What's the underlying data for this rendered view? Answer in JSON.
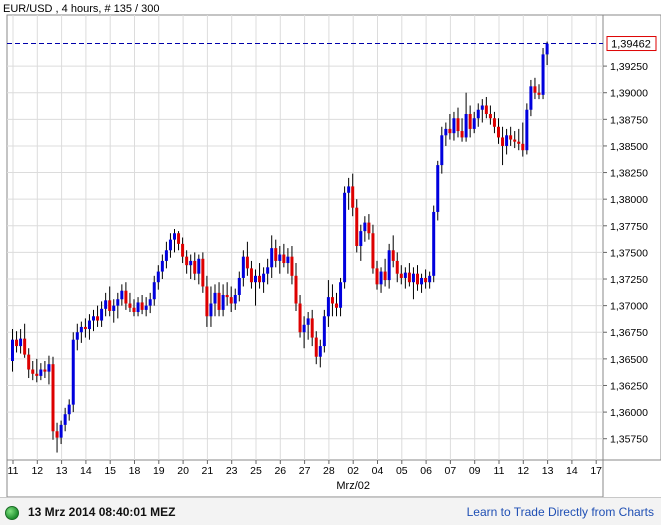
{
  "chart_data": {
    "type": "candlestick",
    "title": "EUR/USD , 4 hours, # 135 / 300",
    "current_price_label": "1,39462",
    "current_price": 1.39462,
    "ylim": [
      1.3555,
      1.3973
    ],
    "yticks": [
      {
        "value": 1.3925,
        "label": "1,39250"
      },
      {
        "value": 1.39,
        "label": "1,39000"
      },
      {
        "value": 1.3875,
        "label": "1,38750"
      },
      {
        "value": 1.385,
        "label": "1,38500"
      },
      {
        "value": 1.3825,
        "label": "1,38250"
      },
      {
        "value": 1.38,
        "label": "1,38000"
      },
      {
        "value": 1.3775,
        "label": "1,37750"
      },
      {
        "value": 1.375,
        "label": "1,37500"
      },
      {
        "value": 1.3725,
        "label": "1,37250"
      },
      {
        "value": 1.37,
        "label": "1,37000"
      },
      {
        "value": 1.3675,
        "label": "1,36750"
      },
      {
        "value": 1.365,
        "label": "1,36500"
      },
      {
        "value": 1.3625,
        "label": "1,36250"
      },
      {
        "value": 1.36,
        "label": "1,36000"
      },
      {
        "value": 1.3575,
        "label": "1,35750"
      }
    ],
    "xticks": [
      "11",
      "12",
      "13",
      "14",
      "15",
      "18",
      "19",
      "20",
      "21",
      "23",
      "25",
      "26",
      "27",
      "28",
      "02",
      "04",
      "05",
      "06",
      "07",
      "09",
      "11",
      "12",
      "13",
      "14",
      "17"
    ],
    "xtick_candle_index": [
      0,
      6,
      12,
      18,
      24,
      30,
      36,
      42,
      48,
      54,
      60,
      66,
      72,
      78,
      84,
      90,
      96,
      102,
      108,
      114,
      120,
      126,
      132,
      138,
      144
    ],
    "xlabel": "Mrz/02",
    "xlabel_candle_index": 84,
    "bull_color": "#0000dd",
    "bear_color": "#dd0000",
    "grid": true,
    "candles": [
      {
        "o": 1.3648,
        "h": 1.3678,
        "l": 1.3638,
        "c": 1.3668
      },
      {
        "o": 1.3668,
        "h": 1.3676,
        "l": 1.3656,
        "c": 1.3662
      },
      {
        "o": 1.3662,
        "h": 1.3678,
        "l": 1.3655,
        "c": 1.3669
      },
      {
        "o": 1.3669,
        "h": 1.3683,
        "l": 1.3651,
        "c": 1.3654
      },
      {
        "o": 1.3654,
        "h": 1.366,
        "l": 1.3632,
        "c": 1.364
      },
      {
        "o": 1.364,
        "h": 1.3648,
        "l": 1.363,
        "c": 1.3636
      },
      {
        "o": 1.3636,
        "h": 1.365,
        "l": 1.3628,
        "c": 1.3634
      },
      {
        "o": 1.3634,
        "h": 1.3646,
        "l": 1.363,
        "c": 1.364
      },
      {
        "o": 1.364,
        "h": 1.3648,
        "l": 1.3632,
        "c": 1.3638
      },
      {
        "o": 1.3638,
        "h": 1.3653,
        "l": 1.3626,
        "c": 1.3645
      },
      {
        "o": 1.3645,
        "h": 1.3652,
        "l": 1.3574,
        "c": 1.3582
      },
      {
        "o": 1.3582,
        "h": 1.359,
        "l": 1.3562,
        "c": 1.3576
      },
      {
        "o": 1.3576,
        "h": 1.3592,
        "l": 1.357,
        "c": 1.3588
      },
      {
        "o": 1.3588,
        "h": 1.3604,
        "l": 1.3582,
        "c": 1.3598
      },
      {
        "o": 1.3598,
        "h": 1.3612,
        "l": 1.3592,
        "c": 1.3607
      },
      {
        "o": 1.3607,
        "h": 1.3675,
        "l": 1.36,
        "c": 1.3668
      },
      {
        "o": 1.3668,
        "h": 1.3683,
        "l": 1.3658,
        "c": 1.3675
      },
      {
        "o": 1.3675,
        "h": 1.3685,
        "l": 1.3665,
        "c": 1.368
      },
      {
        "o": 1.368,
        "h": 1.3688,
        "l": 1.367,
        "c": 1.3678
      },
      {
        "o": 1.3678,
        "h": 1.3692,
        "l": 1.3668,
        "c": 1.3686
      },
      {
        "o": 1.3686,
        "h": 1.3696,
        "l": 1.3676,
        "c": 1.369
      },
      {
        "o": 1.369,
        "h": 1.37,
        "l": 1.368,
        "c": 1.3686
      },
      {
        "o": 1.3686,
        "h": 1.3704,
        "l": 1.368,
        "c": 1.3697
      },
      {
        "o": 1.3697,
        "h": 1.3712,
        "l": 1.369,
        "c": 1.3705
      },
      {
        "o": 1.3705,
        "h": 1.3718,
        "l": 1.369,
        "c": 1.3695
      },
      {
        "o": 1.3695,
        "h": 1.3706,
        "l": 1.3684,
        "c": 1.37
      },
      {
        "o": 1.37,
        "h": 1.3712,
        "l": 1.3688,
        "c": 1.3706
      },
      {
        "o": 1.3706,
        "h": 1.372,
        "l": 1.37,
        "c": 1.3714
      },
      {
        "o": 1.3714,
        "h": 1.3722,
        "l": 1.3696,
        "c": 1.3702
      },
      {
        "o": 1.3702,
        "h": 1.3712,
        "l": 1.3694,
        "c": 1.3698
      },
      {
        "o": 1.3698,
        "h": 1.3706,
        "l": 1.369,
        "c": 1.3694
      },
      {
        "o": 1.3694,
        "h": 1.3708,
        "l": 1.369,
        "c": 1.3703
      },
      {
        "o": 1.3703,
        "h": 1.371,
        "l": 1.3692,
        "c": 1.3696
      },
      {
        "o": 1.3696,
        "h": 1.3708,
        "l": 1.369,
        "c": 1.37
      },
      {
        "o": 1.37,
        "h": 1.3712,
        "l": 1.3693,
        "c": 1.3706
      },
      {
        "o": 1.3706,
        "h": 1.3728,
        "l": 1.37,
        "c": 1.3722
      },
      {
        "o": 1.3722,
        "h": 1.3738,
        "l": 1.3715,
        "c": 1.3732
      },
      {
        "o": 1.3732,
        "h": 1.3748,
        "l": 1.3725,
        "c": 1.3742
      },
      {
        "o": 1.3742,
        "h": 1.376,
        "l": 1.3735,
        "c": 1.3752
      },
      {
        "o": 1.3752,
        "h": 1.3768,
        "l": 1.3745,
        "c": 1.3762
      },
      {
        "o": 1.3762,
        "h": 1.3772,
        "l": 1.375,
        "c": 1.3768
      },
      {
        "o": 1.3768,
        "h": 1.377,
        "l": 1.3752,
        "c": 1.3758
      },
      {
        "o": 1.3758,
        "h": 1.3764,
        "l": 1.374,
        "c": 1.3746
      },
      {
        "o": 1.3746,
        "h": 1.3752,
        "l": 1.373,
        "c": 1.3738
      },
      {
        "o": 1.3738,
        "h": 1.3748,
        "l": 1.3725,
        "c": 1.3742
      },
      {
        "o": 1.3742,
        "h": 1.375,
        "l": 1.3724,
        "c": 1.373
      },
      {
        "o": 1.373,
        "h": 1.3748,
        "l": 1.372,
        "c": 1.3744
      },
      {
        "o": 1.3744,
        "h": 1.375,
        "l": 1.3712,
        "c": 1.3718
      },
      {
        "o": 1.3718,
        "h": 1.3728,
        "l": 1.368,
        "c": 1.369
      },
      {
        "o": 1.369,
        "h": 1.3718,
        "l": 1.368,
        "c": 1.3702
      },
      {
        "o": 1.3702,
        "h": 1.372,
        "l": 1.369,
        "c": 1.3712
      },
      {
        "o": 1.3712,
        "h": 1.3722,
        "l": 1.369,
        "c": 1.3696
      },
      {
        "o": 1.3696,
        "h": 1.372,
        "l": 1.369,
        "c": 1.371
      },
      {
        "o": 1.371,
        "h": 1.3722,
        "l": 1.37,
        "c": 1.3708
      },
      {
        "o": 1.3708,
        "h": 1.3718,
        "l": 1.3694,
        "c": 1.3702
      },
      {
        "o": 1.3702,
        "h": 1.3716,
        "l": 1.3696,
        "c": 1.371
      },
      {
        "o": 1.371,
        "h": 1.3732,
        "l": 1.3704,
        "c": 1.3726
      },
      {
        "o": 1.3726,
        "h": 1.3752,
        "l": 1.3718,
        "c": 1.3746
      },
      {
        "o": 1.3746,
        "h": 1.376,
        "l": 1.3728,
        "c": 1.3735
      },
      {
        "o": 1.3735,
        "h": 1.3742,
        "l": 1.3716,
        "c": 1.3722
      },
      {
        "o": 1.3722,
        "h": 1.3734,
        "l": 1.37,
        "c": 1.3728
      },
      {
        "o": 1.3728,
        "h": 1.374,
        "l": 1.3716,
        "c": 1.3722
      },
      {
        "o": 1.3722,
        "h": 1.3736,
        "l": 1.3712,
        "c": 1.373
      },
      {
        "o": 1.373,
        "h": 1.3744,
        "l": 1.372,
        "c": 1.3736
      },
      {
        "o": 1.3736,
        "h": 1.3766,
        "l": 1.3726,
        "c": 1.3754
      },
      {
        "o": 1.3754,
        "h": 1.3762,
        "l": 1.3736,
        "c": 1.3742
      },
      {
        "o": 1.3742,
        "h": 1.3756,
        "l": 1.373,
        "c": 1.3748
      },
      {
        "o": 1.3748,
        "h": 1.3758,
        "l": 1.3736,
        "c": 1.374
      },
      {
        "o": 1.374,
        "h": 1.3754,
        "l": 1.373,
        "c": 1.3746
      },
      {
        "o": 1.3746,
        "h": 1.3756,
        "l": 1.372,
        "c": 1.3728
      },
      {
        "o": 1.3728,
        "h": 1.374,
        "l": 1.3695,
        "c": 1.3702
      },
      {
        "o": 1.3702,
        "h": 1.371,
        "l": 1.367,
        "c": 1.3675
      },
      {
        "o": 1.3675,
        "h": 1.369,
        "l": 1.366,
        "c": 1.3682
      },
      {
        "o": 1.3682,
        "h": 1.3694,
        "l": 1.3668,
        "c": 1.3688
      },
      {
        "o": 1.3688,
        "h": 1.3696,
        "l": 1.3662,
        "c": 1.367
      },
      {
        "o": 1.367,
        "h": 1.3676,
        "l": 1.3645,
        "c": 1.3652
      },
      {
        "o": 1.3652,
        "h": 1.3668,
        "l": 1.3642,
        "c": 1.3662
      },
      {
        "o": 1.3662,
        "h": 1.3696,
        "l": 1.3656,
        "c": 1.369
      },
      {
        "o": 1.369,
        "h": 1.3724,
        "l": 1.368,
        "c": 1.3708
      },
      {
        "o": 1.3708,
        "h": 1.372,
        "l": 1.369,
        "c": 1.3702
      },
      {
        "o": 1.3702,
        "h": 1.3712,
        "l": 1.369,
        "c": 1.3698
      },
      {
        "o": 1.3698,
        "h": 1.3726,
        "l": 1.369,
        "c": 1.3722
      },
      {
        "o": 1.3722,
        "h": 1.3812,
        "l": 1.3716,
        "c": 1.3806
      },
      {
        "o": 1.3806,
        "h": 1.382,
        "l": 1.379,
        "c": 1.3812
      },
      {
        "o": 1.3812,
        "h": 1.3824,
        "l": 1.3784,
        "c": 1.3792
      },
      {
        "o": 1.3792,
        "h": 1.38,
        "l": 1.375,
        "c": 1.3756
      },
      {
        "o": 1.3756,
        "h": 1.3776,
        "l": 1.3742,
        "c": 1.377
      },
      {
        "o": 1.377,
        "h": 1.3784,
        "l": 1.376,
        "c": 1.3778
      },
      {
        "o": 1.3778,
        "h": 1.3786,
        "l": 1.3762,
        "c": 1.3768
      },
      {
        "o": 1.3768,
        "h": 1.3776,
        "l": 1.373,
        "c": 1.3735
      },
      {
        "o": 1.3735,
        "h": 1.3742,
        "l": 1.3715,
        "c": 1.372
      },
      {
        "o": 1.372,
        "h": 1.3736,
        "l": 1.3712,
        "c": 1.3732
      },
      {
        "o": 1.3732,
        "h": 1.3744,
        "l": 1.3718,
        "c": 1.3724
      },
      {
        "o": 1.3724,
        "h": 1.3758,
        "l": 1.3716,
        "c": 1.3752
      },
      {
        "o": 1.3752,
        "h": 1.3766,
        "l": 1.3736,
        "c": 1.3742
      },
      {
        "o": 1.3742,
        "h": 1.375,
        "l": 1.3722,
        "c": 1.373
      },
      {
        "o": 1.373,
        "h": 1.3738,
        "l": 1.372,
        "c": 1.3726
      },
      {
        "o": 1.3726,
        "h": 1.3736,
        "l": 1.3716,
        "c": 1.3731
      },
      {
        "o": 1.3731,
        "h": 1.374,
        "l": 1.3718,
        "c": 1.3722
      },
      {
        "o": 1.3722,
        "h": 1.3736,
        "l": 1.3706,
        "c": 1.373
      },
      {
        "o": 1.373,
        "h": 1.3738,
        "l": 1.3714,
        "c": 1.372
      },
      {
        "o": 1.372,
        "h": 1.373,
        "l": 1.3712,
        "c": 1.3726
      },
      {
        "o": 1.3726,
        "h": 1.3734,
        "l": 1.3716,
        "c": 1.3722
      },
      {
        "o": 1.3722,
        "h": 1.3732,
        "l": 1.3716,
        "c": 1.3728
      },
      {
        "o": 1.3728,
        "h": 1.3794,
        "l": 1.3722,
        "c": 1.3788
      },
      {
        "o": 1.3788,
        "h": 1.3836,
        "l": 1.378,
        "c": 1.3832
      },
      {
        "o": 1.3832,
        "h": 1.3868,
        "l": 1.3824,
        "c": 1.386
      },
      {
        "o": 1.386,
        "h": 1.3872,
        "l": 1.385,
        "c": 1.3866
      },
      {
        "o": 1.3866,
        "h": 1.388,
        "l": 1.3856,
        "c": 1.3862
      },
      {
        "o": 1.3862,
        "h": 1.3882,
        "l": 1.3855,
        "c": 1.3876
      },
      {
        "o": 1.3876,
        "h": 1.3886,
        "l": 1.3858,
        "c": 1.3864
      },
      {
        "o": 1.3864,
        "h": 1.3876,
        "l": 1.3854,
        "c": 1.3858
      },
      {
        "o": 1.3858,
        "h": 1.39,
        "l": 1.3854,
        "c": 1.388
      },
      {
        "o": 1.388,
        "h": 1.3888,
        "l": 1.3858,
        "c": 1.3866
      },
      {
        "o": 1.3866,
        "h": 1.3882,
        "l": 1.3862,
        "c": 1.3876
      },
      {
        "o": 1.3876,
        "h": 1.389,
        "l": 1.3868,
        "c": 1.3884
      },
      {
        "o": 1.3884,
        "h": 1.3894,
        "l": 1.3872,
        "c": 1.3888
      },
      {
        "o": 1.3888,
        "h": 1.3896,
        "l": 1.3876,
        "c": 1.388
      },
      {
        "o": 1.388,
        "h": 1.3888,
        "l": 1.387,
        "c": 1.3876
      },
      {
        "o": 1.3876,
        "h": 1.3882,
        "l": 1.3862,
        "c": 1.3868
      },
      {
        "o": 1.3868,
        "h": 1.3876,
        "l": 1.3852,
        "c": 1.3858
      },
      {
        "o": 1.3858,
        "h": 1.3868,
        "l": 1.3832,
        "c": 1.385
      },
      {
        "o": 1.385,
        "h": 1.3866,
        "l": 1.3842,
        "c": 1.386
      },
      {
        "o": 1.386,
        "h": 1.3868,
        "l": 1.385,
        "c": 1.3856
      },
      {
        "o": 1.3856,
        "h": 1.3864,
        "l": 1.3848,
        "c": 1.3854
      },
      {
        "o": 1.3854,
        "h": 1.3866,
        "l": 1.3846,
        "c": 1.3852
      },
      {
        "o": 1.3852,
        "h": 1.3872,
        "l": 1.384,
        "c": 1.3846
      },
      {
        "o": 1.3846,
        "h": 1.389,
        "l": 1.3842,
        "c": 1.3884
      },
      {
        "o": 1.3884,
        "h": 1.3912,
        "l": 1.3878,
        "c": 1.3906
      },
      {
        "o": 1.3906,
        "h": 1.3914,
        "l": 1.3894,
        "c": 1.39
      },
      {
        "o": 1.39,
        "h": 1.3908,
        "l": 1.3894,
        "c": 1.3898
      },
      {
        "o": 1.3898,
        "h": 1.3942,
        "l": 1.3894,
        "c": 1.3936
      },
      {
        "o": 1.3936,
        "h": 1.3948,
        "l": 1.3926,
        "c": 1.3946
      }
    ]
  },
  "footer": {
    "timestamp": "13 Mrz 2014 08:40:01 MEZ",
    "link_text": "Learn to Trade Directly from Charts"
  }
}
